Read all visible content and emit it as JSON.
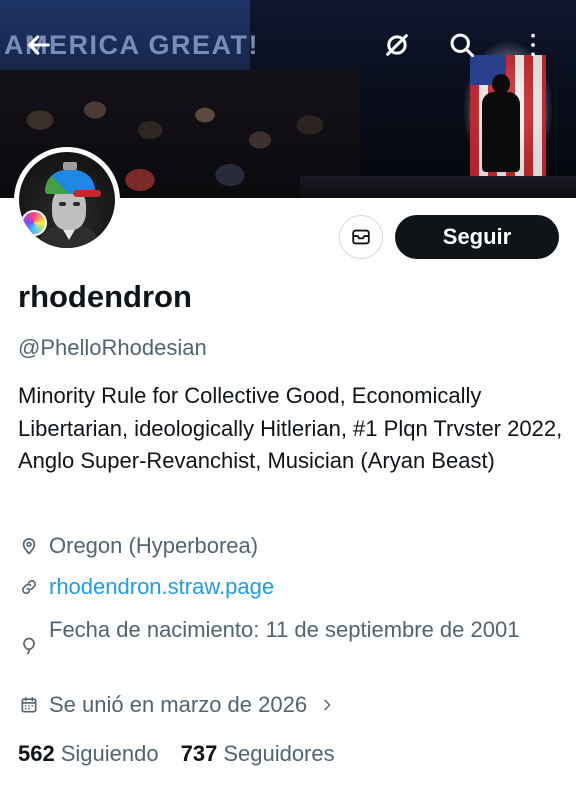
{
  "banner": {
    "sign_text": "AMERICA GREAT!",
    "buttons": {
      "back": "back-arrow-icon",
      "filter": "no-filter-icon",
      "search": "search-icon",
      "more": "more-vertical-icon"
    }
  },
  "actions": {
    "message_icon": "mail-icon",
    "follow_label": "Seguir"
  },
  "profile": {
    "display_name": "rhodendron",
    "handle": "@PhelloRhodesian",
    "bio": "Minority Rule for Collective Good, Economically Libertarian, ideologically Hitlerian, #1 Plqn Trvster 2022, Anglo Super-Revanchist, Musician (Aryan Beast)",
    "location": "Oregon (Hyperborea)",
    "website": "rhodendron.straw.page",
    "birth": "Fecha de nacimiento: 11 de septiembre de 2001",
    "joined": "Se unió en marzo de 2026"
  },
  "stats": {
    "following_count": "562",
    "following_label": "Siguiendo",
    "followers_count": "737",
    "followers_label": "Seguidores"
  },
  "colors": {
    "text": "#0f1419",
    "secondary": "#536471",
    "link": "#1d9bf0",
    "button_bg": "#0f1419"
  }
}
